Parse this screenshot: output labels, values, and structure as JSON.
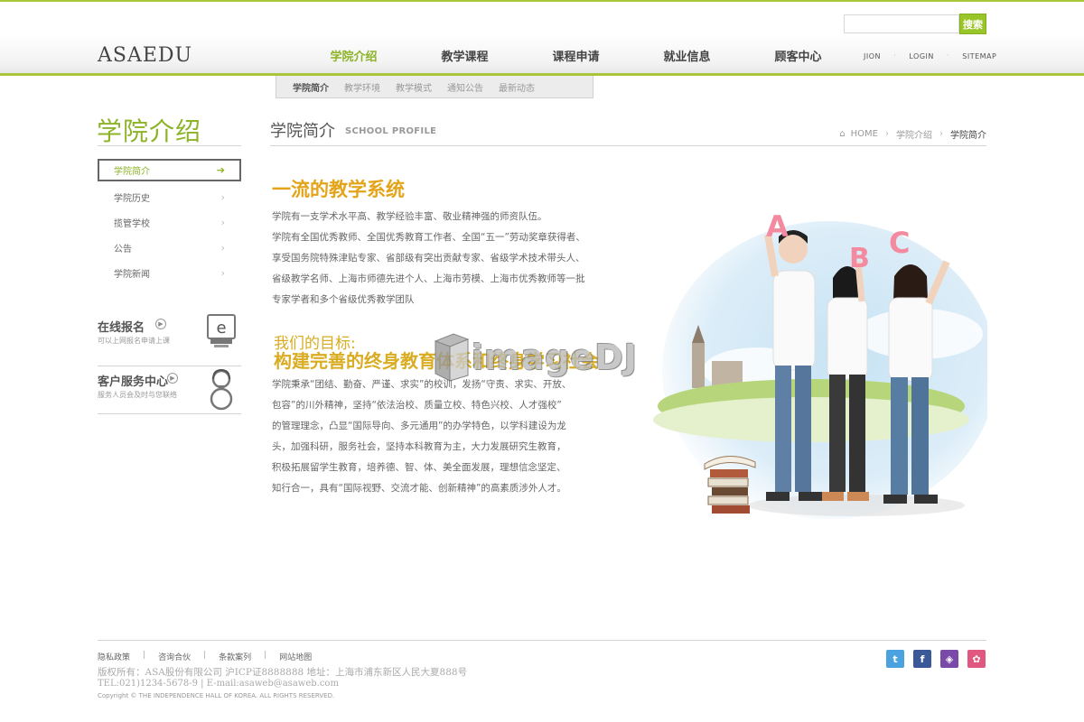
{
  "header": {
    "logo": "ASAEDU",
    "search": {
      "placeholder": "",
      "button": "搜索"
    },
    "nav": [
      {
        "label": "学院介绍",
        "active": true
      },
      {
        "label": "教学课程",
        "active": false
      },
      {
        "label": "课程申请",
        "active": false
      },
      {
        "label": "就业信息",
        "active": false
      },
      {
        "label": "顾客中心",
        "active": false
      }
    ],
    "util_links": [
      "JION",
      "LOGIN",
      "SITEMAP"
    ],
    "sub_nav": [
      {
        "label": "学院简介",
        "active": true
      },
      {
        "label": "教学环境",
        "active": false
      },
      {
        "label": "教学模式",
        "active": false
      },
      {
        "label": "通知公告",
        "active": false
      },
      {
        "label": "最新动态",
        "active": false
      }
    ]
  },
  "sidebar": {
    "title": "学院介绍",
    "items": [
      {
        "label": "学院简介",
        "active": true
      },
      {
        "label": "学院历史",
        "active": false
      },
      {
        "label": "揽管学校",
        "active": false
      },
      {
        "label": "公告",
        "active": false
      },
      {
        "label": "学院新闻",
        "active": false
      }
    ],
    "online_apply": {
      "title": "在线报名",
      "desc": "可以上网报名申请上课"
    },
    "customer_service": {
      "title": "客户服务中心",
      "desc": "服务人员会及时与您联络"
    }
  },
  "content": {
    "title": "学院简介",
    "subtitle": "SCHOOL PROFILE",
    "breadcrumb": [
      "HOME",
      "学院介绍",
      "学院简介"
    ],
    "heading1": "一流的教学系统",
    "para1": [
      "学院有一支学术水平高、教学经验丰富、敬业精神强的师资队伍。",
      "学院有全国优秀教师、全国优秀教育工作者、全国“五一”劳动奖章获得者、",
      "享受国务院特殊津贴专家、省部级有突出贡献专家、省级学术技术带头人、",
      "省级教学名师、上海市师德先进个人、上海市劳模、上海市优秀教师等一批",
      "专家学者和多个省级优秀教学团队"
    ],
    "heading2a": "我们的目标:",
    "heading2b": "构建完善的终身教育体系和终身学习社会",
    "para2": [
      "学院秉承“团结、勤奋、严谨、求实”的校训，发扬“守责、求实、开放、",
      "包容”的川外精神，坚持“依法治校、质量立校、特色兴校、人才强校”",
      "的管理理念，凸显“国际导向、多元通用”的办学特色，以学科建设为龙",
      "头，加强科研，服务社会，坚持本科教育为主，大力发展研究生教育，",
      "积极拓展留学生教育，培养德、智、体、美全面发展，理想信念坚定、",
      "知行合一，具有“国际视野、交流才能、创新精神”的高素质涉外人才。"
    ],
    "watermark": "imageDJ",
    "hero_letters": [
      "A",
      "B",
      "C"
    ]
  },
  "footer": {
    "links": [
      "隐私政策",
      "咨询合伙",
      "条款案列",
      "网站地图"
    ],
    "copyright_line1": "版权所有：ASA股份有限公司 沪ICP证8888888 地址：上海市浦东新区人民大夏888号",
    "copyright_line2": "TEL:021)1234-5678-9 | E-mail:asaweb@asaweb.com",
    "copyright_line3": "Copyright © THE INDEPENDENCE HALL OF KOREA. ALL RIGHTS RESERVED.",
    "social": [
      {
        "name": "twitter-icon",
        "glyph": "t",
        "color": "#4aa3df"
      },
      {
        "name": "facebook-icon",
        "glyph": "f",
        "color": "#3b5998"
      },
      {
        "name": "shield-icon",
        "glyph": "◈",
        "color": "#7a4aa8"
      },
      {
        "name": "pig-icon",
        "glyph": "✿",
        "color": "#e0577f"
      }
    ]
  },
  "colors": {
    "accent": "#8db326",
    "heading": "#e3a41a"
  }
}
